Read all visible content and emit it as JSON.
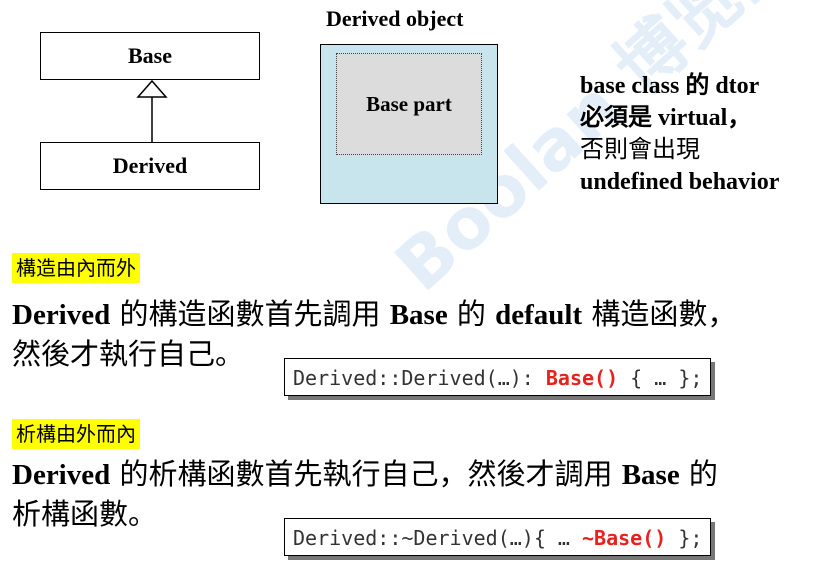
{
  "diagram": {
    "base_box": "Base",
    "derived_box": "Derived",
    "object_title": "Derived object",
    "base_part": "Base part"
  },
  "note": {
    "line1": "base class 的 dtor",
    "line2": "必須是 virtual，",
    "line3": "否則會出現",
    "line4": "undefined behavior"
  },
  "section1": {
    "tag": "構造由內而外",
    "line1_a": "Derived",
    "line1_b": " 的構造函數首先調用 ",
    "line1_c": "Base",
    "line1_d": " 的 ",
    "line1_e": "default",
    "line1_f": " 構造函數，",
    "line2": "然後才執行自己。",
    "code_a": "Derived::Derived(…): ",
    "code_kw": "Base()",
    "code_b": " { … };"
  },
  "section2": {
    "tag": "析構由外而內",
    "line1_a": "Derived",
    "line1_b": " 的析構函數首先執行自己，然後才調用 ",
    "line1_c": "Base",
    "line1_d": " 的",
    "line2": "析構函數。",
    "code_a": "Derived::~Derived(…){ … ",
    "code_kw": "~Base()",
    "code_b": " };"
  },
  "watermark": "Boolan 博览网",
  "colors": {
    "highlight": "#ffff00",
    "object_fill": "#c8e4ec",
    "base_part_fill": "#dcdcdc",
    "code_keyword": "#e8211d"
  }
}
